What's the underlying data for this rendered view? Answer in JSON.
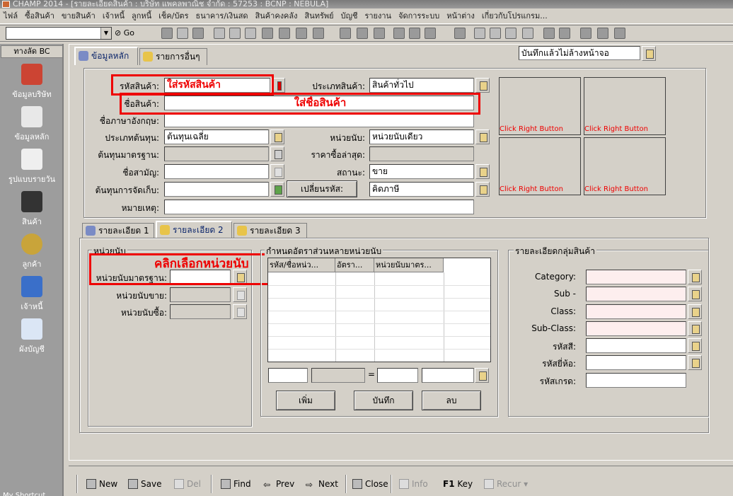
{
  "window": {
    "title": "CHAMP 2014 - [รายละเอียดสินค้า : บริษัท แพคลพาณิช จำกัด : 57253 : BCNP : NEBULA]"
  },
  "menu": [
    "ไฟล์",
    "ซื้อสินค้า",
    "ขายสินค้า",
    "เจ้าหนี้",
    "ลูกหนี้",
    "เช็ค/บัตร",
    "ธนาคาร/เงินสด",
    "สินค้าคงคลัง",
    "สินทรัพย์",
    "บัญชี",
    "รายงาน",
    "จัดการระบบ",
    "หน้าต่าง",
    "เกี่ยวกับโปรแกรม..."
  ],
  "toolbar": {
    "go_label": "Go"
  },
  "left": {
    "header": "ทางลัด BC",
    "items": [
      "ข้อมูลบริษัท",
      "ข้อมูลหลัก",
      "รูปแบบรายวัน",
      "สินค้า",
      "ลูกค้า",
      "เจ้าหนี้",
      "ผังบัญชี"
    ]
  },
  "tabs": [
    "ข้อมูลหลัก",
    "รายการอื่นๆ"
  ],
  "save_mode": "บันทึกแล้วไม่ล้างหน้าจอ",
  "form": {
    "code_label": "รหัสสินค้า:",
    "code_value": "ใส่รหัสสินค้า",
    "type_label": "ประเภทสินค้า:",
    "type_value": "สินค้าทั่วไป",
    "name_label": "ชื่อสินค้า:",
    "name_value": "ใส่ชื่อสินค้า",
    "eng_label": "ชื่อภาษาอังกฤษ:",
    "costtype_label": "ประเภทต้นทุน:",
    "costtype_value": "ต้นทุนเฉลี่ย",
    "unit_label": "หน่วยนับ:",
    "unit_value": "หน่วยนับเดียว",
    "stdcost_label": "ต้นทุนมาตรฐาน:",
    "lastprice_label": "ราคาซื้อล่าสุด:",
    "alias_label": "ชื่อสามัญ:",
    "status_label": "สถานะ:",
    "status_value": "ขาย",
    "storecost_label": "ต้นทุนการจัดเก็บ:",
    "changecode_button": "เปลี่ยนรหัส:",
    "tax_value": "คิดภาษี",
    "note_label": "หมายเหตุ:"
  },
  "pictures": [
    "Click Right Button",
    "Click Right Button",
    "Click Right Button",
    "Click Right Button"
  ],
  "subtabs": [
    "รายละเอียด 1",
    "รายละเอียด 2",
    "รายละเอียด 3"
  ],
  "unit_group": {
    "title": "หน่วยนับ",
    "std_label": "หน่วยนับมาตรฐาน:",
    "sell_label": "หน่วยนับขาย:",
    "buy_label": "หน่วยนับซื้อ:",
    "annotation": "คลิกเลือกหน่วยนับ"
  },
  "ratio_group": {
    "title": "กำหนดอัตราส่วนหลายหน่วยนับ",
    "columns": [
      "รหัส/ชื่อหน่ว...",
      "อัตรา...",
      "หน่วยนับมาตร..."
    ],
    "equals": "=",
    "add_button": "เพิ่ม",
    "save_button": "บันทึก",
    "delete_button": "ลบ"
  },
  "group_detail": {
    "title": "รายละเอียดกลุ่มสินค้า",
    "labels": [
      "Category:",
      "Sub -",
      "Class:",
      "Sub-Class:",
      "รหัสสี:",
      "รหัสยี่ห้อ:",
      "รหัสเกรด:"
    ]
  },
  "bottom": {
    "new": "New",
    "save": "Save",
    "del": "Del",
    "find": "Find",
    "prev": "Prev",
    "next": "Next",
    "close": "Close",
    "info": "Info",
    "key_prefix": "F1",
    "key": "Key",
    "recur": "Recur"
  },
  "status_left": "My Shortcut"
}
